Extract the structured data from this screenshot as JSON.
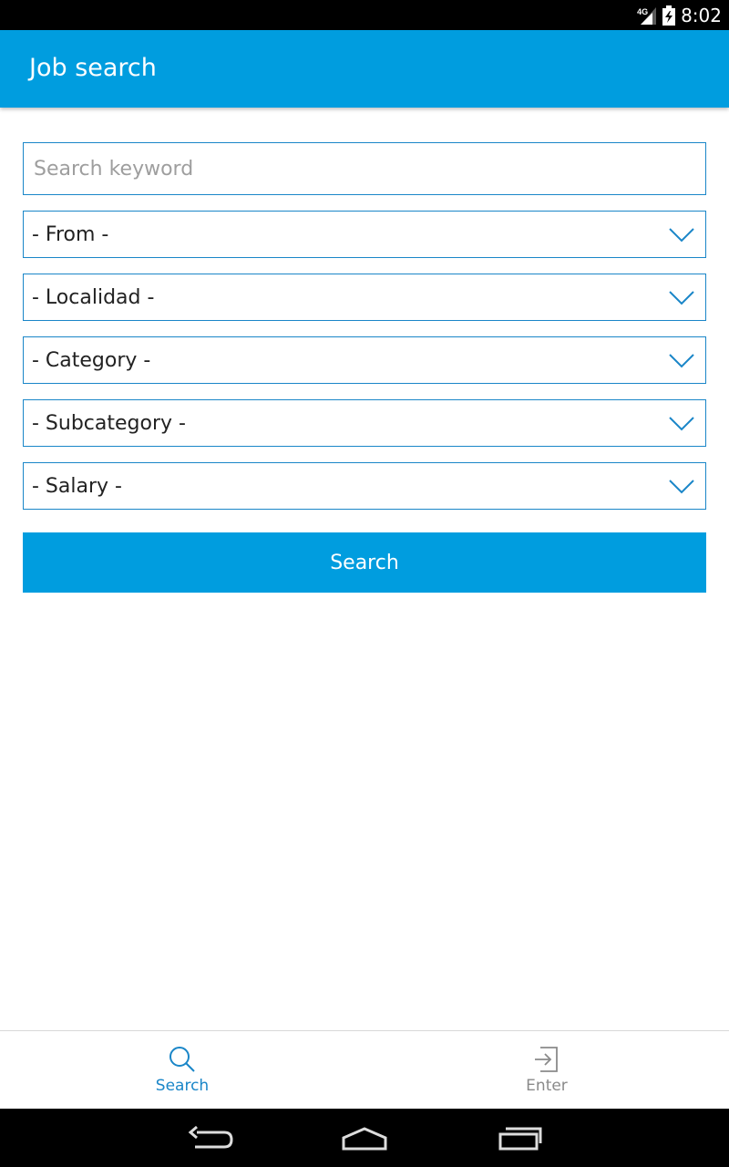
{
  "status_bar": {
    "network": "4G",
    "time": "8:02"
  },
  "app_bar": {
    "title": "Job search"
  },
  "form": {
    "keyword": {
      "placeholder": "Search keyword",
      "value": ""
    },
    "selects": [
      {
        "label": "- From -"
      },
      {
        "label": "- Localidad -"
      },
      {
        "label": "- Category -"
      },
      {
        "label": "- Subcategory -"
      },
      {
        "label": "- Salary -"
      }
    ],
    "search_button_label": "Search"
  },
  "bottom_nav": {
    "items": [
      {
        "label": "Search",
        "icon": "search-icon",
        "active": true
      },
      {
        "label": "Enter",
        "icon": "enter-icon",
        "active": false
      }
    ]
  },
  "colors": {
    "primary": "#009ddf",
    "border": "#1a86c8",
    "nav_active": "#1a86c8",
    "nav_inactive": "#8a8a8a"
  }
}
